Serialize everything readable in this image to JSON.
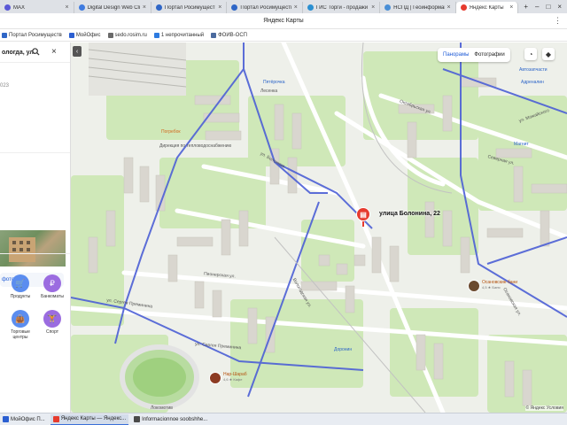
{
  "browser": {
    "tabs": [
      {
        "label": "MAX",
        "color": "#5a58d6"
      },
      {
        "label": "Digital Design Web Client",
        "color": "#3f7be0"
      },
      {
        "label": "Портал Росимущества",
        "color": "#2f66c7"
      },
      {
        "label": "Портал Росимущества",
        "color": "#2f66c7"
      },
      {
        "label": "ГИС Торги - продажи и аре",
        "color": "#2a8fd1"
      },
      {
        "label": "НСПД | Геоинформационн",
        "color": "#4a8fd6"
      },
      {
        "label": "Яндекс Карты",
        "color": "#e63b2e",
        "active": true
      }
    ],
    "window_controls": [
      "+",
      "–",
      "□",
      "×"
    ],
    "title": "Яндекс Карты",
    "more_icon": "⋮",
    "bookmarks": [
      {
        "label": "Портал Росимуществ",
        "color": "#2f66c7"
      },
      {
        "label": "МойОфис",
        "color": "#2b5fd1"
      },
      {
        "label": "sedo.rosim.ru",
        "color": "#6a6a6a"
      },
      {
        "label": "1 непрочитанный",
        "color": "#2d7be0"
      },
      {
        "label": "ФОИВ-ОСП",
        "color": "#4b6a9e"
      }
    ]
  },
  "panel": {
    "search_value": "ологда, ул.",
    "year": "023",
    "photo_link": "фото",
    "categories": [
      {
        "label": "Продукты",
        "color": "#5b8def",
        "icon": "cart-icon",
        "glyph": "🛒"
      },
      {
        "label": "Банкоматы",
        "color": "#9b6ce0",
        "icon": "ruble-icon",
        "glyph": "₽"
      },
      {
        "label": "Торговые центры",
        "color": "#5b8def",
        "icon": "bag-icon",
        "glyph": "👜"
      },
      {
        "label": "Спорт",
        "color": "#9b6ce0",
        "icon": "dumbbell-icon",
        "glyph": "🏋"
      }
    ]
  },
  "map": {
    "modes": {
      "panoramas": "Панорамы",
      "photos": "Фотографии"
    },
    "pin_label": "улица Болонина, 22",
    "labels": [
      {
        "text": "Пятёрочка",
        "kind": "blue"
      },
      {
        "text": "Лесенка",
        "kind": "plain"
      },
      {
        "text": "Погребок",
        "kind": "orange"
      },
      {
        "text": "Дирекция по тепловодоснабжению",
        "kind": "plain"
      },
      {
        "text": "Автозапчасти",
        "kind": "blue"
      },
      {
        "text": "Адреналин",
        "kind": "blue"
      },
      {
        "text": "Магнит",
        "kind": "blue"
      },
      {
        "text": "Октябрьская ул.",
        "kind": "plain"
      },
      {
        "text": "ул. Можайского",
        "kind": "plain"
      },
      {
        "text": "Северная ул.",
        "kind": "plain"
      },
      {
        "text": "Пионерская ул.",
        "kind": "plain"
      },
      {
        "text": "ул. Сергея Преминина",
        "kind": "plain"
      },
      {
        "text": "ул. Сергея Преминина",
        "kind": "plain"
      },
      {
        "text": "ул. Болонина",
        "kind": "plain"
      },
      {
        "text": "Вологодская ул.",
        "kind": "plain"
      },
      {
        "text": "Доронин",
        "kind": "blue"
      },
      {
        "text": "Локомотив",
        "kind": "plain"
      },
      {
        "text": "Осановская ул.",
        "kind": "plain"
      }
    ],
    "pois": [
      {
        "title": "Осановские бани",
        "sub": "4,5 ★ Баня"
      },
      {
        "title": "Нар-Шараб",
        "sub": "4,6 ★ Кафе"
      }
    ],
    "copyright": "© Яндекс Условия"
  },
  "taskbar": {
    "items": [
      {
        "label": "МойОфис П...",
        "color": "#2b5fd1"
      },
      {
        "label": "Яндекс Карты — Яндекс...",
        "color": "#e63b2e",
        "active": true
      },
      {
        "label": "Informacionnoe soobshhe...",
        "color": "#4a4a4a"
      }
    ]
  }
}
